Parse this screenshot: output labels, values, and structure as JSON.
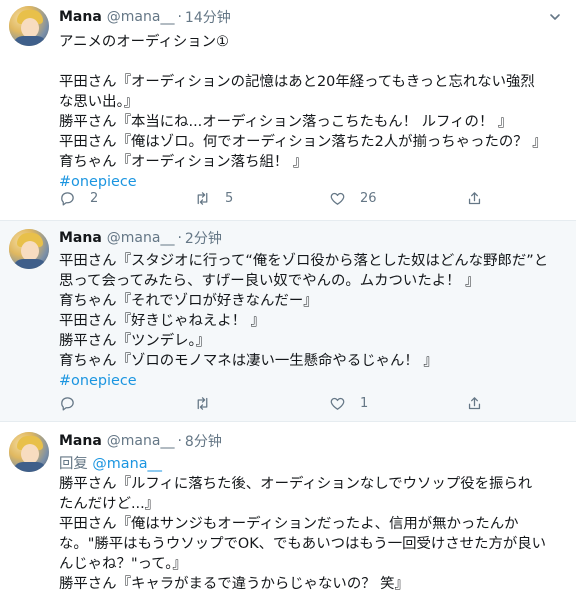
{
  "colors": {
    "link": "#1b95e0",
    "meta": "#657786",
    "text": "#14171a",
    "divider": "#e6ecf0",
    "highlight_bg": "#f5f8fa"
  },
  "tweets": [
    {
      "name": "Mana",
      "handle": "@mana__",
      "dot": "·",
      "time": "14分钟",
      "lines": [
        "アニメのオーディション①",
        "",
        "平田さん『オーディションの記憶はあと20年経ってもきっと忘れない強烈",
        "な思い出。』",
        "勝平さん『本当にね...オーディション落っこちたもん！ ルフィの！ 』",
        "平田さん『俺はゾロ。何でオーディション落ちた2人が揃っちゃったの？ 』",
        "育ちゃん『オーディション落ち組！ 』"
      ],
      "hashtag": "#onepiece",
      "actions": {
        "reply_count": "2",
        "retweet_count": "5",
        "like_count": "26"
      }
    },
    {
      "name": "Mana",
      "handle": "@mana__",
      "dot": "·",
      "time": "2分钟",
      "lines": [
        "平田さん『スタジオに行って“俺をゾロ役から落とした奴はどんな野郎だ”と",
        "思って会ってみたら、すげー良い奴でやんの。ムカついたよ！ 』",
        "育ちゃん『それでゾロが好きなんだー』",
        "平田さん『好きじゃねえよ！ 』",
        "勝平さん『ツンデレ。』",
        "育ちゃん『ゾロのモノマネは凄い一生懸命やるじゃん！ 』"
      ],
      "hashtag": "#onepiece",
      "actions": {
        "reply_count": "",
        "retweet_count": "",
        "like_count": "1"
      }
    },
    {
      "name": "Mana",
      "handle": "@mana__",
      "dot": "·",
      "time": "8分钟",
      "reply_label": "回复",
      "reply_to": "@mana__",
      "lines": [
        "勝平さん『ルフィに落ちた後、オーディションなしでウソップ役を振られ",
        "たんだけど...』",
        "平田さん『俺はサンジもオーディションだったよ、信用が無かったんか",
        "な。\"勝平はもうウソップでOK、でもあいつはもう一回受けさせた方が良い",
        "んじゃね？\"って。』",
        "勝平さん『キャラがまるで違うからじゃないの？ 笑』"
      ]
    }
  ]
}
